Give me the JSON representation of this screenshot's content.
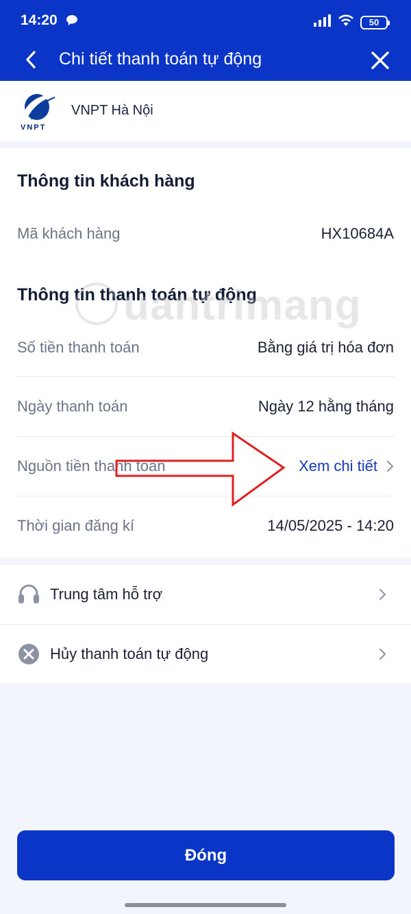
{
  "status_bar": {
    "time": "14:20",
    "battery": "50"
  },
  "nav": {
    "title": "Chi tiết thanh toán tự động"
  },
  "provider": {
    "name": "VNPT Hà Nội",
    "logo_text": "VNPT"
  },
  "customer_section": {
    "title": "Thông tin khách hàng",
    "rows": [
      {
        "label": "Mã khách hàng",
        "value": "HX10684A"
      }
    ]
  },
  "payment_section": {
    "title": "Thông tin thanh toán tự động",
    "rows": [
      {
        "label": "Số tiền thanh toán",
        "value": "Bằng giá trị hóa đơn"
      },
      {
        "label": "Ngày thanh toán",
        "value": "Ngày 12 hằng tháng"
      },
      {
        "label": "Nguồn tiền thanh toán",
        "value": "Xem chi tiết"
      },
      {
        "label": "Thời gian đăng kí",
        "value": "14/05/2025 - 14:20"
      }
    ]
  },
  "actions": [
    {
      "label": "Trung tâm hỗ trợ",
      "icon": "headset-icon"
    },
    {
      "label": "Hủy thanh toán tự động",
      "icon": "cancel-circle-icon"
    }
  ],
  "watermark": {
    "text": "uantrimang"
  },
  "footer": {
    "close_label": "Đóng"
  },
  "colors": {
    "primary": "#0a35c7",
    "link": "#1638b8",
    "annotation_arrow": "#e02020"
  }
}
